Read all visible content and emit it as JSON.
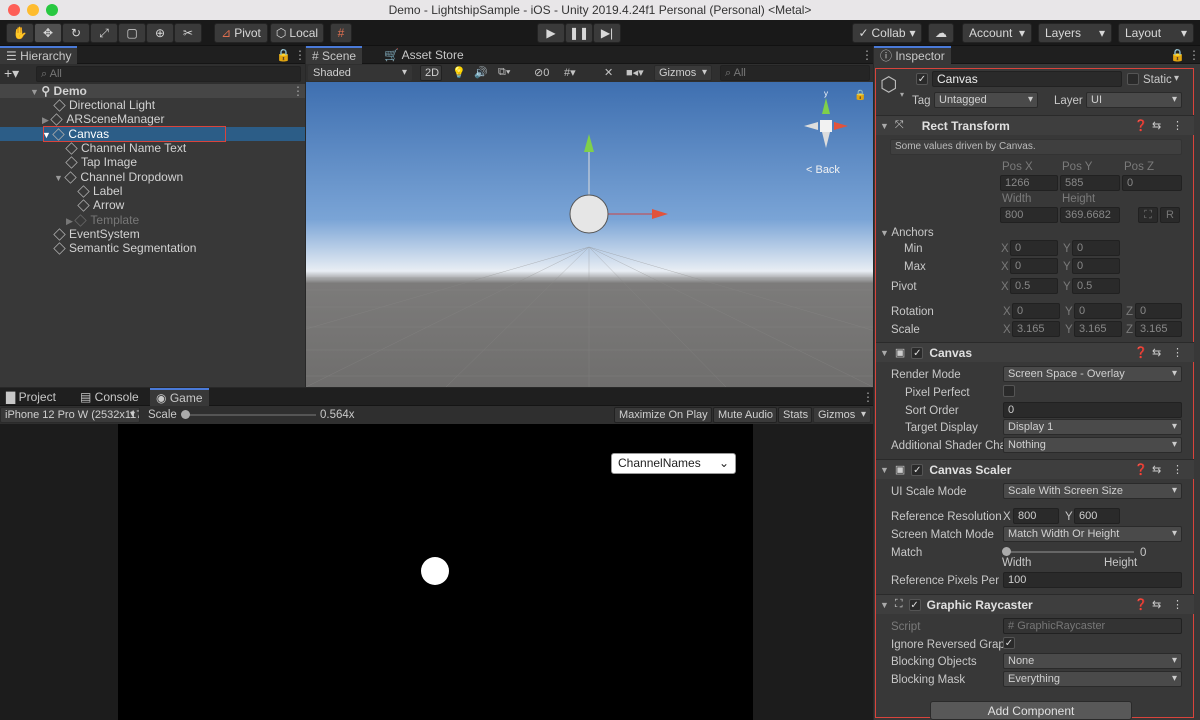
{
  "window": {
    "title": "Demo - LightshipSample - iOS - Unity 2019.4.24f1 Personal (Personal) <Metal>"
  },
  "toolbar": {
    "pivot_label": "Pivot",
    "local_label": "Local",
    "collab_label": "Collab",
    "account_label": "Account",
    "layers_label": "Layers",
    "layout_label": "Layout"
  },
  "hierarchy": {
    "tab": "Hierarchy",
    "search_placeholder": "All",
    "items": [
      {
        "label": "Demo"
      },
      {
        "label": "Directional Light"
      },
      {
        "label": "ARSceneManager"
      },
      {
        "label": "Canvas"
      },
      {
        "label": "Channel Name Text"
      },
      {
        "label": "Tap Image"
      },
      {
        "label": "Channel Dropdown"
      },
      {
        "label": "Label"
      },
      {
        "label": "Arrow"
      },
      {
        "label": "Template"
      },
      {
        "label": "EventSystem"
      },
      {
        "label": "Semantic Segmentation"
      }
    ]
  },
  "scene": {
    "tabs": [
      "Scene",
      "Asset Store"
    ],
    "shading": "Shaded",
    "mode2d": "2D",
    "hidden_count": "0",
    "gizmos": "Gizmos",
    "search_placeholder": "All",
    "back_label": "< Back"
  },
  "game": {
    "tabs": [
      "Project",
      "Console",
      "Game"
    ],
    "device": "iPhone 12 Pro W (2532x1170)",
    "scale_label": "Scale",
    "scale_value": 0.564,
    "scale_text": "0.564x",
    "maximize": "Maximize On Play",
    "mute": "Mute Audio",
    "stats": "Stats",
    "gizmos": "Gizmos",
    "dropdown_value": "ChannelNames"
  },
  "inspector": {
    "tab": "Inspector",
    "object_name": "Canvas",
    "static_label": "Static",
    "tag_label": "Tag",
    "tag_value": "Untagged",
    "layer_label": "Layer",
    "layer_value": "UI",
    "rect_transform": {
      "title": "Rect Transform",
      "note": "Some values driven by Canvas.",
      "pos_x_label": "Pos X",
      "pos_y_label": "Pos Y",
      "pos_z_label": "Pos Z",
      "pos_x": "1266",
      "pos_y": "585",
      "pos_z": "0",
      "width_label": "Width",
      "height_label": "Height",
      "width": "800",
      "height": "369.6682",
      "r_button": "R",
      "anchors_label": "Anchors",
      "min_label": "Min",
      "max_label": "Max",
      "min_x": "0",
      "min_y": "0",
      "max_x": "0",
      "max_y": "0",
      "pivot_label": "Pivot",
      "pivot_x": "0.5",
      "pivot_y": "0.5",
      "rotation_label": "Rotation",
      "rot_x": "0",
      "rot_y": "0",
      "rot_z": "0",
      "scale_label": "Scale",
      "scale_x": "3.165",
      "scale_y": "3.165",
      "scale_z": "3.165",
      "x": "X",
      "y": "Y",
      "z": "Z"
    },
    "canvas": {
      "title": "Canvas",
      "render_mode_label": "Render Mode",
      "render_mode": "Screen Space - Overlay",
      "pixel_perfect_label": "Pixel Perfect",
      "sort_order_label": "Sort Order",
      "sort_order": "0",
      "target_display_label": "Target Display",
      "target_display": "Display 1",
      "shader_label": "Additional Shader Cha",
      "shader_value": "Nothing"
    },
    "canvas_scaler": {
      "title": "Canvas Scaler",
      "ui_scale_mode_label": "UI Scale Mode",
      "ui_scale_mode": "Scale With Screen Size",
      "ref_res_label": "Reference Resolution",
      "ref_x": "800",
      "ref_y": "600",
      "match_mode_label": "Screen Match Mode",
      "match_mode": "Match Width Or Height",
      "match_label": "Match",
      "match_value": "0",
      "width_label": "Width",
      "height_label": "Height",
      "ref_ppu_label": "Reference Pixels Per U",
      "ref_ppu": "100"
    },
    "graphic_raycaster": {
      "title": "Graphic Raycaster",
      "script_label": "Script",
      "script_value": "GraphicRaycaster",
      "ignore_label": "Ignore Reversed Grapl",
      "blocking_objects_label": "Blocking Objects",
      "blocking_objects": "None",
      "blocking_mask_label": "Blocking Mask",
      "blocking_mask": "Everything"
    },
    "add_component": "Add Component"
  },
  "colors": {
    "accent": "#2c5d87",
    "highlight": "#d9443c"
  }
}
